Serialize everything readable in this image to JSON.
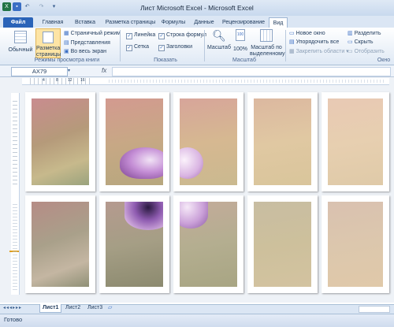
{
  "window": {
    "title": "Лист Microsoft Excel - Microsoft Excel"
  },
  "tabs": [
    {
      "label": "Файл"
    },
    {
      "label": "Главная"
    },
    {
      "label": "Вставка"
    },
    {
      "label": "Разметка страницы"
    },
    {
      "label": "Формулы"
    },
    {
      "label": "Данные"
    },
    {
      "label": "Рецензирование"
    },
    {
      "label": "Вид"
    }
  ],
  "ribbon": {
    "views": {
      "normal": "Обычный",
      "page_layout_1": "Разметка",
      "page_layout_2": "страницы",
      "page_break": "Страничный режим",
      "custom": "Представления",
      "fullscreen": "Во весь экран",
      "group_label": "Режимы просмотра книги"
    },
    "show": {
      "ruler": "Линейка",
      "formula_bar": "Строка формул",
      "grid": "Сетка",
      "headings": "Заголовки",
      "group_label": "Показать"
    },
    "zoom": {
      "zoom": "Масштаб",
      "hundred": "100%",
      "selection_1": "Масштаб по",
      "selection_2": "выделенному",
      "group_label": "Масштаб"
    },
    "window": {
      "new_window": "Новое окно",
      "arrange_all": "Упорядочить все",
      "freeze": "Закрепить области",
      "split": "Разделить",
      "hide": "Скрыть",
      "unhide": "Отобразить",
      "group_label": "Окно"
    }
  },
  "formula_bar": {
    "name_box": "AX79",
    "fx": "fx",
    "value": ""
  },
  "ruler": {
    "h_marks": [
      "4",
      "8",
      "12",
      "16"
    ]
  },
  "sheet_tabs": [
    "Лист1",
    "Лист2",
    "Лист3"
  ],
  "status": {
    "text": "Готово"
  },
  "colors": {
    "file_tab": "#2a63b8",
    "ribbon_bg": "#dfe9f5"
  }
}
